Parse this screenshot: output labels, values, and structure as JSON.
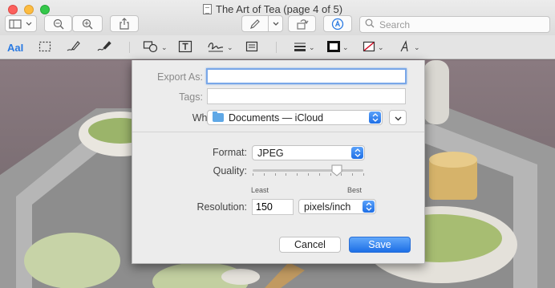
{
  "window": {
    "title": "The Art of Tea (page 4 of 5)",
    "search_placeholder": "Search"
  },
  "markup_toolbar": {
    "text_style_label": "AaI"
  },
  "export_sheet": {
    "export_as_label": "Export As:",
    "export_as_value": "",
    "tags_label": "Tags:",
    "tags_value": "",
    "where_label": "Where:",
    "where_value": "Documents — iCloud",
    "format_label": "Format:",
    "format_value": "JPEG",
    "quality_label": "Quality:",
    "quality_level": 0.76,
    "quality_min_label": "Least",
    "quality_max_label": "Best",
    "resolution_label": "Resolution:",
    "resolution_value": "150",
    "resolution_unit": "pixels/inch",
    "cancel_label": "Cancel",
    "save_label": "Save"
  },
  "colors": {
    "accent": "#1f6fe6",
    "close": "#fc605c",
    "minimize": "#fdbc40",
    "zoom": "#34c84a"
  },
  "icons": [
    "sidebar-icon",
    "zoom-out-icon",
    "zoom-in-icon",
    "share-icon",
    "pen-icon",
    "chevron-down-icon",
    "rotate-icon",
    "markup-icon",
    "search-icon",
    "selection-icon",
    "sketch-icon",
    "draw-icon",
    "shapes-icon",
    "text-box-icon",
    "sign-icon",
    "note-icon",
    "line-style-icon",
    "border-color-icon",
    "fill-color-icon",
    "font-icon",
    "folder-icon"
  ]
}
